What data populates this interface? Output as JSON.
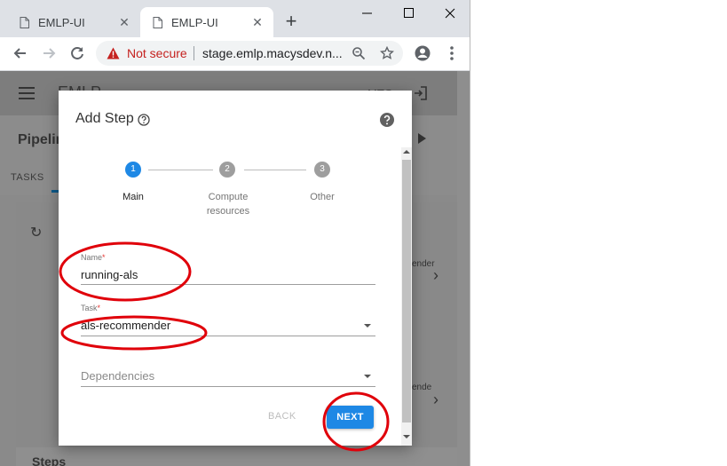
{
  "browser": {
    "tabs": [
      {
        "title": "EMLP-UI",
        "active": false
      },
      {
        "title": "EMLP-UI",
        "active": true
      }
    ],
    "security_label": "Not secure",
    "url": "stage.emlp.macysdev.n..."
  },
  "app": {
    "title": "EMLP",
    "user": "MTG",
    "section_title": "Pipelin",
    "tabs": [
      "TASKS"
    ],
    "background_labels": [
      "ender",
      "ende"
    ],
    "steps_title": "Steps"
  },
  "dialog": {
    "title": "Add Step",
    "stepper": [
      {
        "number": "1",
        "label": "Main",
        "active": true
      },
      {
        "number": "2",
        "label": "Compute resources",
        "active": false
      },
      {
        "number": "3",
        "label": "Other",
        "active": false
      }
    ],
    "fields": {
      "name": {
        "label": "Name",
        "required_mark": "*",
        "value": "running-als"
      },
      "task": {
        "label": "Task",
        "required_mark": "*",
        "value": "als-recommender"
      },
      "dependencies": {
        "placeholder": "Dependencies",
        "value": ""
      }
    },
    "buttons": {
      "back": "BACK",
      "next": "NEXT"
    }
  },
  "colors": {
    "primary": "#1e88e5",
    "inactive_step": "#9e9e9e",
    "warning": "#c5221f",
    "annotation": "#e0000a"
  }
}
